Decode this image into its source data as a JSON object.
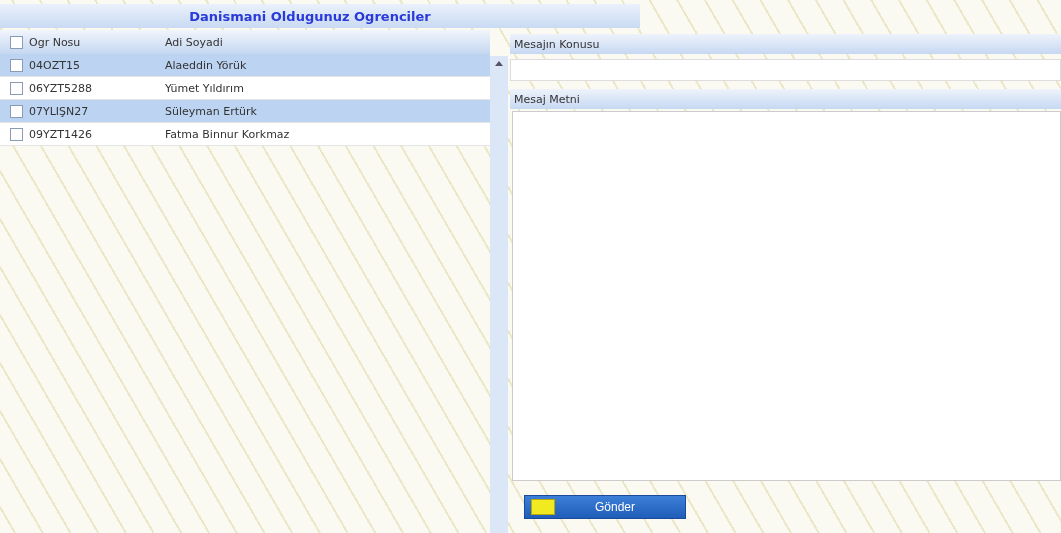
{
  "title": "Danismani Oldugunuz Ogrenciler",
  "table": {
    "columns": [
      "Ogr Nosu",
      "Adi Soyadi"
    ],
    "header_checked": false,
    "rows": [
      {
        "no": "04OZT15",
        "name": "Alaeddin Yörük",
        "selected": true,
        "checked": false
      },
      {
        "no": "06YZT5288",
        "name": "Yümet Yıldırım",
        "selected": false,
        "checked": false
      },
      {
        "no": "07YLIŞN27",
        "name": "Süleyman Ertürk",
        "selected": true,
        "checked": false
      },
      {
        "no": "09YZT1426",
        "name": "Fatma Binnur Korkmaz",
        "selected": false,
        "checked": false
      }
    ]
  },
  "subject": {
    "label": "Mesajın Konusu"
  },
  "body": {
    "label": "Mesaj Metni"
  },
  "send_button": "Gönder"
}
